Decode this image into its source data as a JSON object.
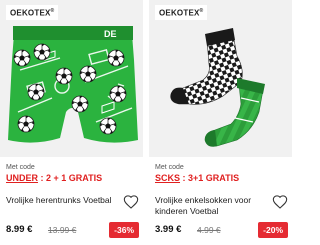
{
  "products": [
    {
      "badge": "OEKOTEX",
      "badge_sup": "®",
      "code_label": "Met code",
      "code": "UNDER",
      "code_separator": " : ",
      "code_offer": "2 + 1 GRATIS",
      "title": "Vrolijke herentrunks Voetbal",
      "price": "8.99 €",
      "old_price": "13.99 €",
      "discount": "-36%",
      "waistband_text": "DE",
      "icon": "heart-outline-icon"
    },
    {
      "badge": "OEKOTEX",
      "badge_sup": "®",
      "code_label": "Met code",
      "code": "SCKS",
      "code_separator": " : ",
      "code_offer": "3+1 GRATIS",
      "title": "Vrolijke enkelsokken voor kinderen Voetbal",
      "price": "3.99 €",
      "old_price": "4.99 €",
      "discount": "-20%",
      "icon": "heart-outline-icon"
    }
  ],
  "colors": {
    "accent_red": "#e02020",
    "discount_bg": "#e52b32",
    "pitch_green": "#2bb33f"
  }
}
